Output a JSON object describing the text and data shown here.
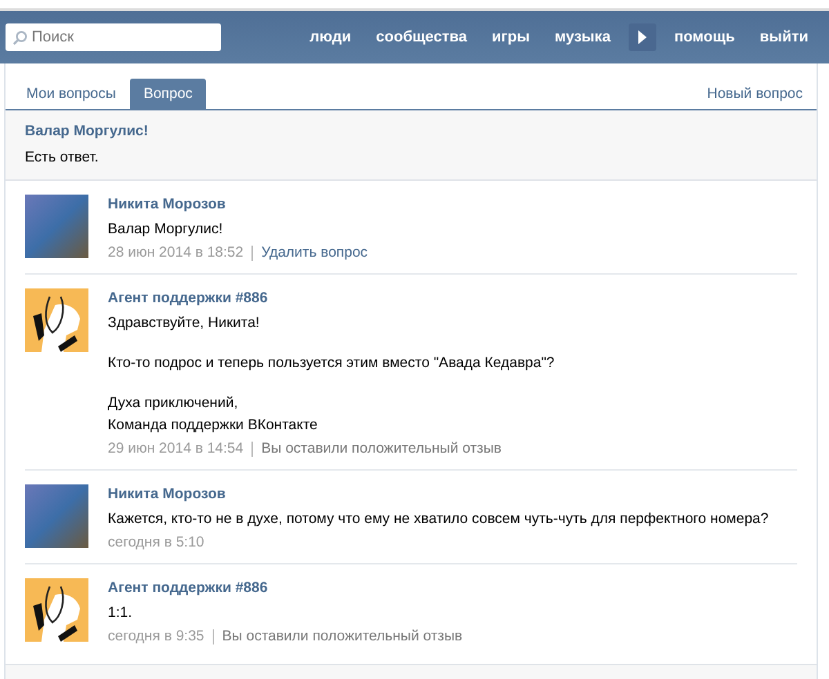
{
  "header": {
    "search": {
      "placeholder": "Поиск"
    },
    "nav": [
      "люди",
      "сообщества",
      "игры",
      "музыка"
    ],
    "nav_right": [
      "помощь",
      "выйти"
    ]
  },
  "tabs": [
    {
      "label": "Мои вопросы",
      "selected": false
    },
    {
      "label": "Вопрос",
      "selected": true
    }
  ],
  "new_question": "Новый вопрос",
  "question": {
    "title": "Валар Моргулис!",
    "status": "Есть ответ."
  },
  "messages": [
    {
      "kind": "user",
      "author": "Никита Морозов",
      "paragraphs": [
        [
          "Валар Моргулис!"
        ]
      ],
      "time": "28 июн 2014 в 18:52",
      "action": {
        "kind": "link",
        "text": "Удалить вопрос"
      }
    },
    {
      "kind": "agent",
      "author": "Агент поддержки #886",
      "paragraphs": [
        [
          "Здравствуйте, Никита!"
        ],
        [
          "Кто-то подрос и теперь пользуется этим вместо \"Авада Кедавра\"?"
        ],
        [
          "Духа приключений,",
          "Команда поддержки ВКонтакте"
        ]
      ],
      "time": "29 июн 2014 в 14:54",
      "action": {
        "kind": "note",
        "text": "Вы оставили положительный отзыв"
      }
    },
    {
      "kind": "user",
      "author": "Никита Морозов",
      "paragraphs": [
        [
          "Кажется, кто-то не в духе, потому что ему не хватило совсем чуть-чуть для перфектного номера?"
        ]
      ],
      "time": "сегодня в 5:10"
    },
    {
      "kind": "agent",
      "author": "Агент поддержки #886",
      "paragraphs": [
        [
          "1:1."
        ]
      ],
      "time": "сегодня в 9:35",
      "action": {
        "kind": "note",
        "text": "Вы оставили положительный отзыв"
      }
    }
  ]
}
